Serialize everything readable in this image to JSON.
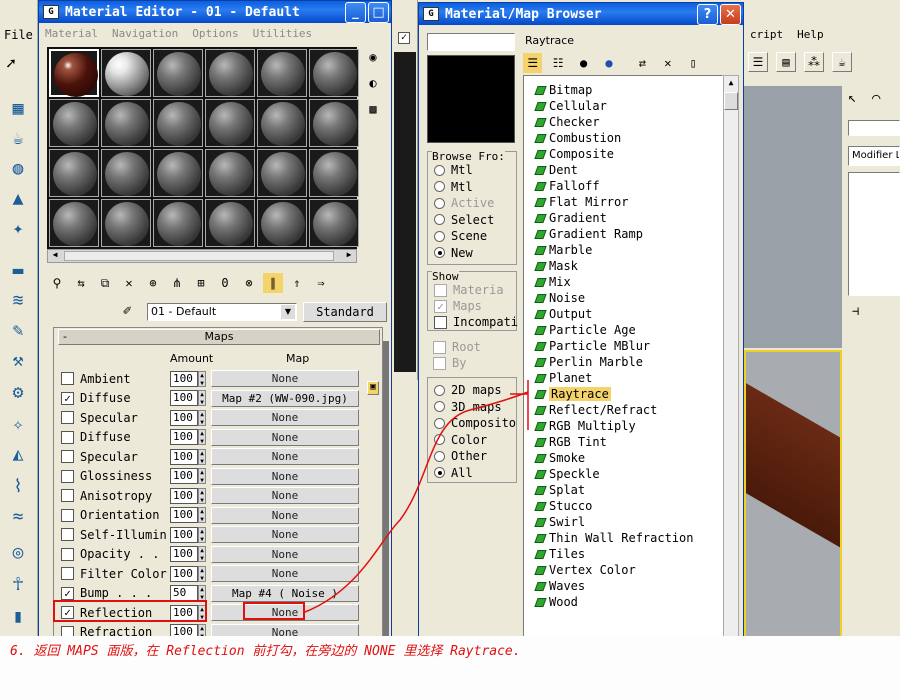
{
  "material_editor": {
    "title": "Material Editor - 01 - Default",
    "menu": [
      "Material",
      "Navigation",
      "Options",
      "Utilities"
    ],
    "material_name": "01 - Default",
    "type_button": "Standard",
    "rollout_title": "Maps",
    "col_amount": "Amount",
    "col_map": "Map",
    "rows": [
      {
        "label": "Ambient",
        "checked": false,
        "amount": "100",
        "map": "None"
      },
      {
        "label": "Diffuse",
        "checked": true,
        "amount": "100",
        "map": "Map #2 (WW-090.jpg)"
      },
      {
        "label": "Specular",
        "checked": false,
        "amount": "100",
        "map": "None"
      },
      {
        "label": "Diffuse",
        "checked": false,
        "amount": "100",
        "map": "None"
      },
      {
        "label": "Specular",
        "checked": false,
        "amount": "100",
        "map": "None"
      },
      {
        "label": "Glossiness",
        "checked": false,
        "amount": "100",
        "map": "None"
      },
      {
        "label": "Anisotropy",
        "checked": false,
        "amount": "100",
        "map": "None"
      },
      {
        "label": "Orientation",
        "checked": false,
        "amount": "100",
        "map": "None"
      },
      {
        "label": "Self-Illumin",
        "checked": false,
        "amount": "100",
        "map": "None"
      },
      {
        "label": "Opacity . .",
        "checked": false,
        "amount": "100",
        "map": "None"
      },
      {
        "label": "Filter Color",
        "checked": false,
        "amount": "100",
        "map": "None"
      },
      {
        "label": "Bump . . .",
        "checked": true,
        "amount": "50",
        "map": "Map #4 ( Noise )"
      },
      {
        "label": "Reflection",
        "checked": true,
        "amount": "100",
        "map": "None"
      },
      {
        "label": "Refraction",
        "checked": false,
        "amount": "100",
        "map": "None"
      }
    ]
  },
  "browser": {
    "title": "Material/Map Browser",
    "name_field": "Raytrace",
    "browse_from_label": "Browse Fro:",
    "browse_from": [
      {
        "label": "Mtl",
        "on": false,
        "dim": false
      },
      {
        "label": "Mtl",
        "on": false,
        "dim": false
      },
      {
        "label": "Active",
        "on": false,
        "dim": true
      },
      {
        "label": "Select",
        "on": false,
        "dim": false
      },
      {
        "label": "Scene",
        "on": false,
        "dim": false
      },
      {
        "label": "New",
        "on": true,
        "dim": false
      }
    ],
    "show_label": "Show",
    "show": [
      {
        "label": "Materia",
        "checked": false,
        "dim": true
      },
      {
        "label": "Maps",
        "checked": true,
        "dim": true
      },
      {
        "label": "Incompati",
        "checked": false,
        "dim": false
      }
    ],
    "root_label": "Root",
    "by_label": "By",
    "categories": [
      {
        "label": "2D maps",
        "on": false
      },
      {
        "label": "3D maps",
        "on": false
      },
      {
        "label": "Composito",
        "on": false
      },
      {
        "label": "Color",
        "on": false
      },
      {
        "label": "Other",
        "on": false
      },
      {
        "label": "All",
        "on": true
      }
    ],
    "maps": [
      "Bitmap",
      "Cellular",
      "Checker",
      "Combustion",
      "Composite",
      "Dent",
      "Falloff",
      "Flat Mirror",
      "Gradient",
      "Gradient Ramp",
      "Marble",
      "Mask",
      "Mix",
      "Noise",
      "Output",
      "Particle Age",
      "Particle MBlur",
      "Perlin Marble",
      "Planet",
      "Raytrace",
      "Reflect/Refract",
      "RGB Multiply",
      "RGB Tint",
      "Smoke",
      "Speckle",
      "Splat",
      "Stucco",
      "Swirl",
      "Thin Wall Refraction",
      "Tiles",
      "Vertex Color",
      "Waves",
      "Wood"
    ],
    "highlighted": "Raytrace"
  },
  "main_app": {
    "menu_left": "File",
    "menu_right": [
      "cript",
      "Help"
    ],
    "modifier_label": "Modifier L"
  },
  "caption": "6. 返回 MAPS 面版，在 Reflection 前打勾，在旁边的 NONE 里选择 Raytrace.",
  "colors": {
    "annotation": "#e01010",
    "highlight": "#f4d36a",
    "title_blue": "#0a5fe0"
  }
}
